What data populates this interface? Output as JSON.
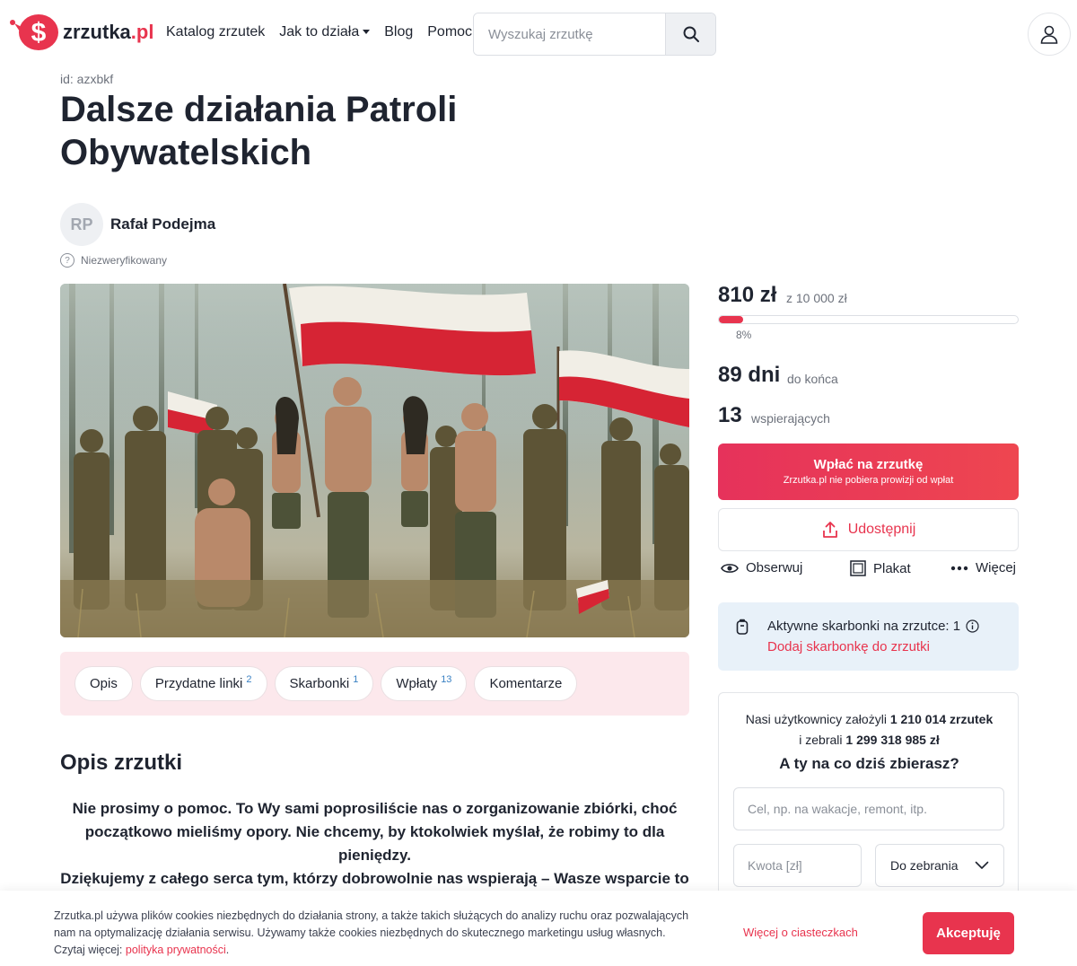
{
  "header": {
    "logo_text": "zrzutka",
    "logo_suffix": ".pl",
    "nav": [
      "Katalog zrzutek",
      "Jak to działa",
      "Blog",
      "Pomoc"
    ],
    "search_placeholder": "Wyszukaj zrzutkę"
  },
  "campaign": {
    "id_label": "id: azxbkf",
    "title": "Dalsze działania Patroli Obywatelskich",
    "author_initials": "RP",
    "author_name": "Rafał Podejma",
    "verification": "Niezweryfikowany"
  },
  "tabs": [
    {
      "label": "Opis",
      "count": ""
    },
    {
      "label": "Przydatne linki",
      "count": "2"
    },
    {
      "label": "Skarbonki",
      "count": "1"
    },
    {
      "label": "Wpłaty",
      "count": "13"
    },
    {
      "label": "Komentarze",
      "count": ""
    }
  ],
  "description": {
    "heading": "Opis zrzutki",
    "lines": [
      "Nie prosimy o pomoc. To Wy sami poprosiliście nas o zorganizowanie zbiórki, choć",
      "początkowo mieliśmy opory. Nie chcemy, by ktokolwiek myślał, że robimy to dla",
      "pieniędzy.",
      "Dziękujemy z całego serca tym, którzy dobrowolnie nas wspierają – Wasze wsparcie to"
    ]
  },
  "funding": {
    "raised": "810 zł",
    "goal": "z 10 000 zł",
    "progress_fraction": 0.081,
    "percent_label": "8%",
    "days_value": "89 dni",
    "days_label": "do końca",
    "supporters_value": "13",
    "supporters_label": "wspierających"
  },
  "buttons": {
    "donate_main": "Wpłać na zrzutkę",
    "donate_sub": "Zrzutka.pl nie pobiera prowizji od wpłat",
    "share": "Udostępnij",
    "follow": "Obserwuj",
    "poster": "Plakat",
    "more": "Więcej"
  },
  "piggybanks": {
    "active": "Aktywne skarbonki na zrzutce: 1",
    "add_link": "Dodaj skarbonkę do zrzutki"
  },
  "cta": {
    "stats_prefix": "Nasi użytkownicy założyli",
    "stats_count": "1 210 014 zrzutek",
    "stats_mid": "i zebrali",
    "stats_total": "1 299 318 985 zł",
    "question": "A ty na co dziś zbierasz?",
    "goal_placeholder": "Cel, np. na wakacje, remont, itp.",
    "amount_placeholder": "Kwota [zł]",
    "type_selected": "Do zebrania"
  },
  "cookie": {
    "text": "Zrzutka.pl używa plików cookies niezbędnych do działania strony, a także takich służących do analizy ruchu oraz pozwalających nam na optymalizację działania serwisu. Używamy także cookies niezbędnych do skutecznego marketingu usług własnych. Czytaj więcej: ",
    "policy_link": "polityka prywatności",
    "after_link": ".",
    "more_link": "Więcej o ciasteczkach",
    "accept": "Akceptuję"
  },
  "colors": {
    "brand": "#e8344e",
    "info_bg": "#e8f1f9",
    "tabs_bg": "#fce8ec"
  }
}
